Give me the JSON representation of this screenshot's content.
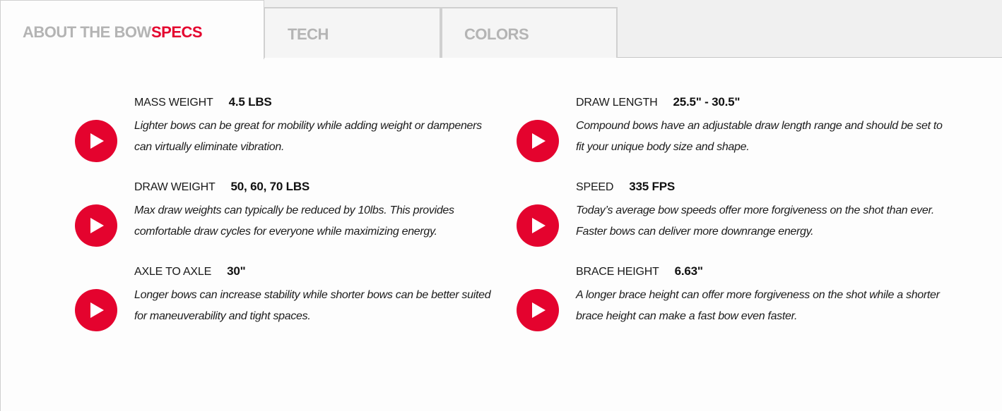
{
  "tabs": {
    "about_label": "ABOUT THE BOW",
    "specs_label": "SPECS",
    "tech_label": "TECH",
    "colors_label": "COLORS"
  },
  "specs": [
    {
      "title": "MASS WEIGHT",
      "value": "4.5 LBS",
      "description": "Lighter bows can be great for mobility while adding weight or dampeners can virtually eliminate vibration."
    },
    {
      "title": "DRAW LENGTH",
      "value": "25.5\" - 30.5\"",
      "description": "Compound bows have an adjustable draw length range and should be set to fit your unique body size and shape."
    },
    {
      "title": "DRAW WEIGHT",
      "value": "50, 60, 70 LBS",
      "description": "Max draw weights can typically be reduced by 10lbs. This provides comfortable draw cycles for everyone while maximizing energy."
    },
    {
      "title": "SPEED",
      "value": "335 FPS",
      "description": "Today’s average bow speeds offer more forgiveness on the shot than ever. Faster bows can deliver more downrange energy."
    },
    {
      "title": "AXLE TO AXLE",
      "value": "30\"",
      "description": "Longer bows can increase stability while shorter bows can be better suited for maneuverability and tight spaces."
    },
    {
      "title": "BRACE HEIGHT",
      "value": "6.63\"",
      "description": "A longer brace height can offer more forgiveness on the shot while a shorter brace height can make a fast bow even faster."
    }
  ],
  "colors": {
    "accent": "#e4032e",
    "tab_text_inactive": "#b4b4b4"
  },
  "icons": {
    "play": "play-icon"
  }
}
